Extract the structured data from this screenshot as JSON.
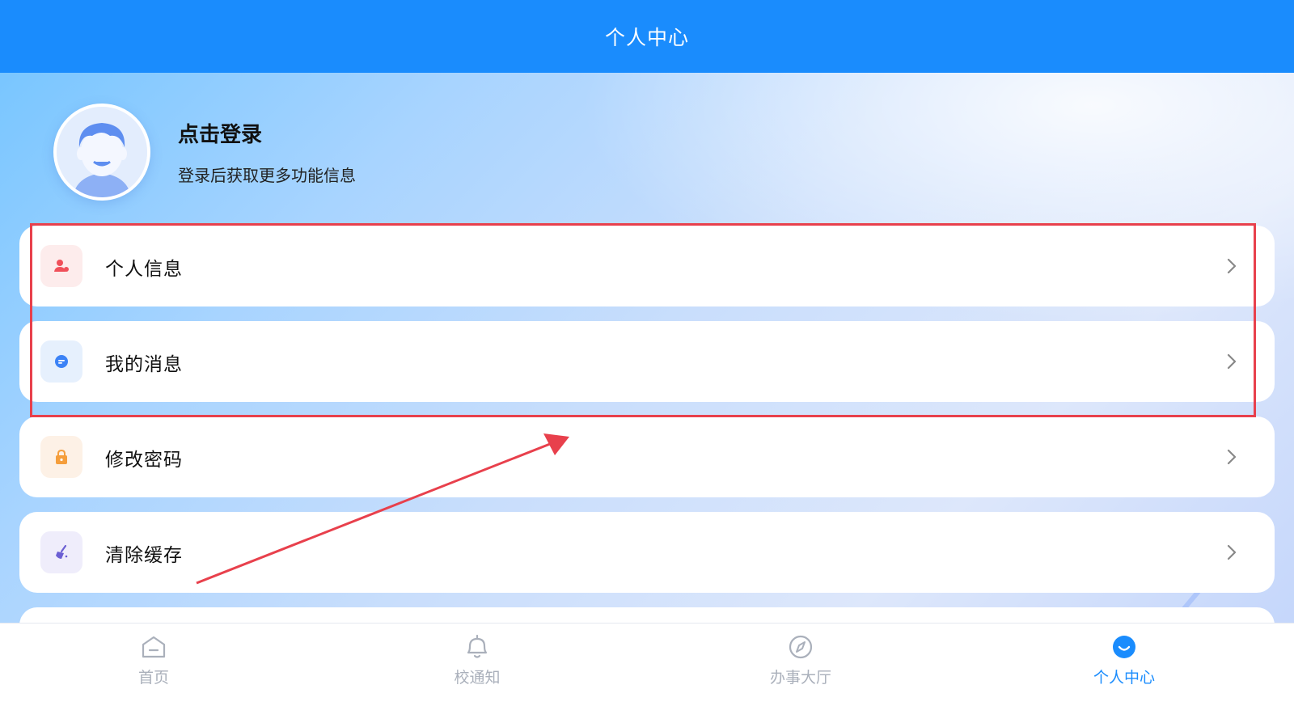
{
  "header": {
    "title": "个人中心"
  },
  "profile": {
    "login_title": "点击登录",
    "login_subtitle": "登录后获取更多功能信息"
  },
  "menu": [
    {
      "label": "个人信息",
      "icon": "user-icon",
      "color": "#f0505a",
      "bg": "#fdecec"
    },
    {
      "label": "我的消息",
      "icon": "message-icon",
      "color": "#3b82f6",
      "bg": "#e6f0fd"
    },
    {
      "label": "修改密码",
      "icon": "lock-icon",
      "color": "#f59e3c",
      "bg": "#fdf1e6"
    },
    {
      "label": "清除缓存",
      "icon": "broom-icon",
      "color": "#6b5fd3",
      "bg": "#efedfb"
    }
  ],
  "tabs": [
    {
      "label": "首页",
      "icon": "home-icon",
      "active": false
    },
    {
      "label": "校通知",
      "icon": "bell-icon",
      "active": false
    },
    {
      "label": "办事大厅",
      "icon": "compass-icon",
      "active": false
    },
    {
      "label": "个人中心",
      "icon": "smile-icon",
      "active": true
    }
  ],
  "colors": {
    "primary": "#1a8cfd",
    "annotation": "#e8404c"
  }
}
